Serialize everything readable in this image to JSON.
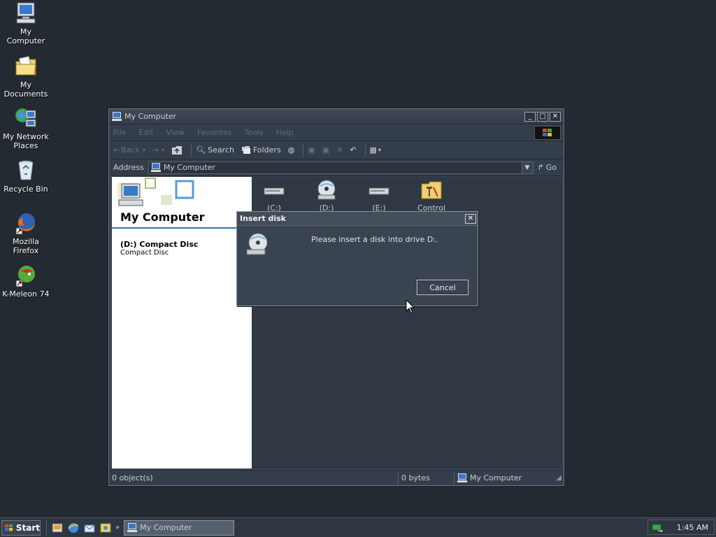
{
  "desktop": {
    "icons": [
      {
        "label": "My Computer",
        "icon": "computer-icon"
      },
      {
        "label": "My Documents",
        "icon": "folder-documents-icon"
      },
      {
        "label": "My Network Places",
        "icon": "network-places-icon"
      },
      {
        "label": "Recycle Bin",
        "icon": "recycle-bin-icon"
      },
      {
        "label": "Mozilla Firefox",
        "icon": "firefox-icon"
      },
      {
        "label": "K-Meleon 74",
        "icon": "kmeleon-icon"
      }
    ]
  },
  "window": {
    "title": "My Computer",
    "menu": [
      "File",
      "Edit",
      "View",
      "Favorites",
      "Tools",
      "Help"
    ],
    "toolbar": {
      "back": "Back",
      "search": "Search",
      "folders": "Folders"
    },
    "address": {
      "label": "Address",
      "value": "My Computer",
      "go": "Go"
    },
    "left_pane": {
      "title": "My Computer",
      "details_name": "(D:) Compact Disc",
      "details_type": "Compact Disc"
    },
    "drives": [
      {
        "label": "(C:) Windows",
        "icon": "hard-drive-icon"
      },
      {
        "label": "(D:) Compact",
        "icon": "cd-drive-icon"
      },
      {
        "label": "(E:) Windows",
        "icon": "hard-drive-icon"
      },
      {
        "label": "Control Panel",
        "icon": "control-panel-icon"
      }
    ],
    "status": {
      "objects": "0 object(s)",
      "size": "0 bytes",
      "location": "My Computer"
    }
  },
  "dialog": {
    "title": "Insert disk",
    "message": "Please insert a disk into drive D:.",
    "cancel": "Cancel"
  },
  "taskbar": {
    "start": "Start",
    "task": "My Computer",
    "clock": "1:45 AM"
  }
}
